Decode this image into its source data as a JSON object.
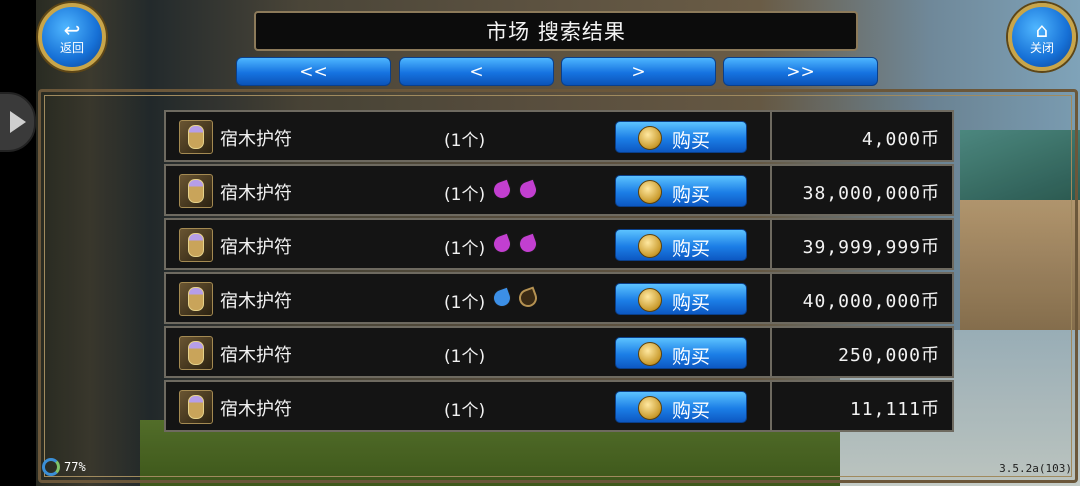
{
  "header": {
    "title": "市场  搜索结果",
    "back_label": "返回",
    "close_label": "关闭"
  },
  "pagination": [
    "<<",
    "<",
    ">",
    ">>"
  ],
  "rows": [
    {
      "name": "宿木护符",
      "qty": "(1个)",
      "gems": [],
      "buy_label": "购买",
      "price": "4,000币"
    },
    {
      "name": "宿木护符",
      "qty": "(1个)",
      "gems": [
        "purple",
        "purple"
      ],
      "buy_label": "购买",
      "price": "38,000,000币"
    },
    {
      "name": "宿木护符",
      "qty": "(1个)",
      "gems": [
        "purple",
        "purple"
      ],
      "buy_label": "购买",
      "price": "39,999,999币"
    },
    {
      "name": "宿木护符",
      "qty": "(1个)",
      "gems": [
        "blue",
        "empty"
      ],
      "buy_label": "购买",
      "price": "40,000,000币"
    },
    {
      "name": "宿木护符",
      "qty": "(1个)",
      "gems": [],
      "buy_label": "购买",
      "price": "250,000币"
    },
    {
      "name": "宿木护符",
      "qty": "(1个)",
      "gems": [],
      "buy_label": "购买",
      "price": "11,111币"
    }
  ],
  "status": {
    "battery": "77%",
    "version": "3.5.2a(103)"
  },
  "colors": {
    "gem_purple": "#c23fd0",
    "gem_blue": "#3c8fe6",
    "gem_empty": "#3a2a14",
    "button_blue": "#1b7ee6"
  }
}
